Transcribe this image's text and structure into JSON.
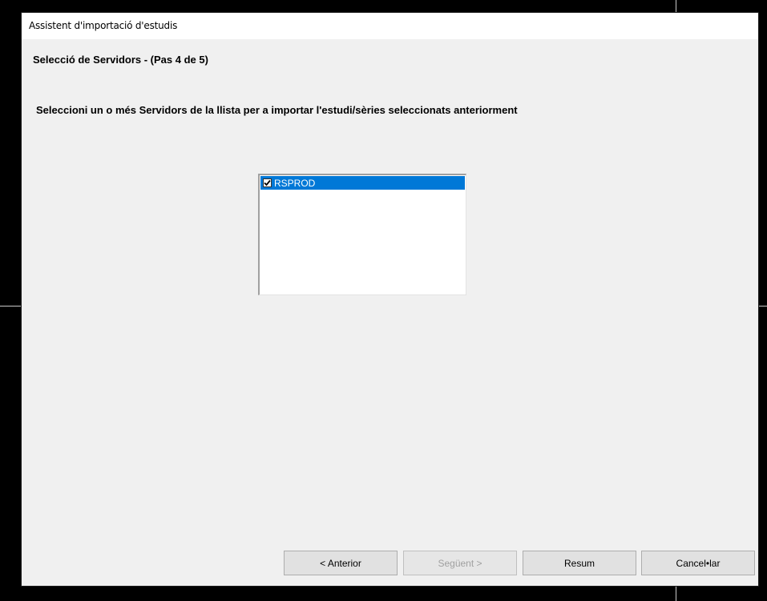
{
  "window": {
    "title": "Assistent d'importació d'estudis"
  },
  "wizard": {
    "step_title": "Selecció de Servidors - (Pas 4 de 5)",
    "instruction": "Seleccioni un o més Servidors de la llista per a importar l'estudi/sèries seleccionats anteriorment"
  },
  "servers": {
    "items": [
      {
        "label": "RSPROD",
        "checked": true,
        "selected": true
      }
    ],
    "selection_color": "#0078d7"
  },
  "buttons": {
    "previous": "< Anterior",
    "next": "Següent >",
    "summary": "Resum",
    "cancel": "Cancel•lar"
  }
}
